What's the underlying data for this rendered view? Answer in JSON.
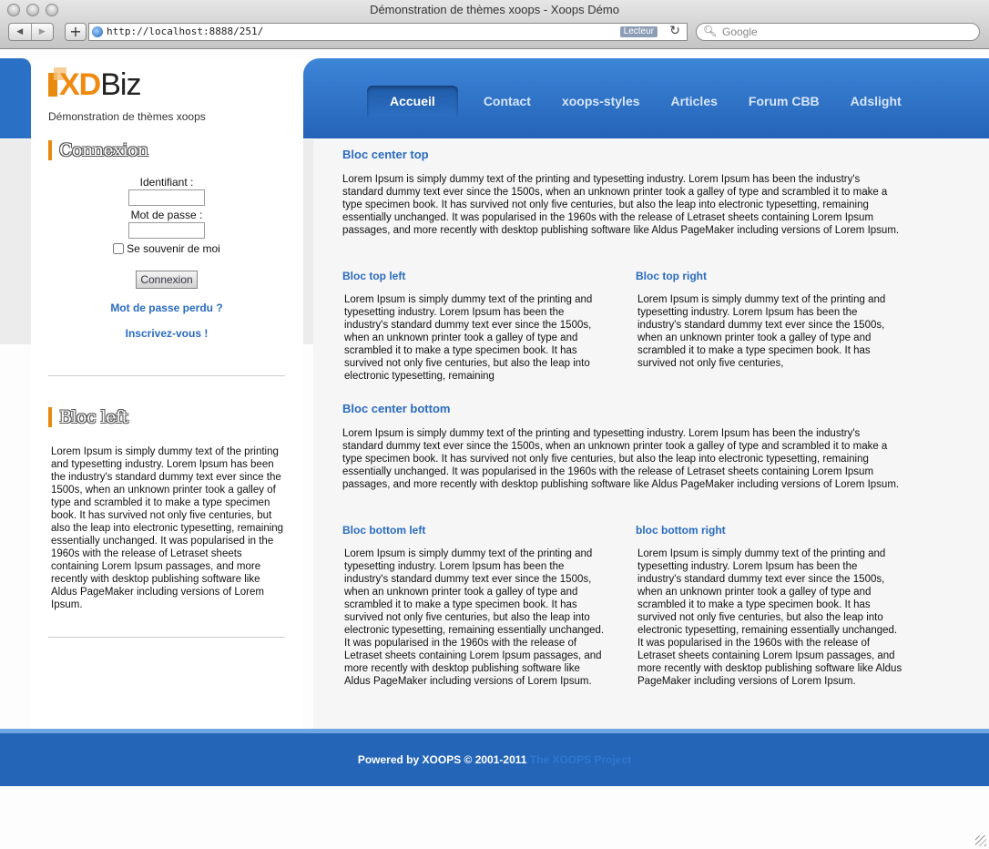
{
  "browser": {
    "window_title": "Démonstration de thèmes xoops - Xoops Démo",
    "back_icon": "◀",
    "forward_icon": "▶",
    "add_icon": "+",
    "url": "http://localhost:8888/251/",
    "reader_label": "Lecteur",
    "reload_icon": "↻",
    "search_icon": "🔍︎",
    "search_placeholder": "Google"
  },
  "site": {
    "logo_xd": "XD",
    "logo_biz": "Biz",
    "subtitle": "Démonstration de thèmes xoops"
  },
  "nav": {
    "items": [
      "Accueil",
      "Contact",
      "xoops-styles",
      "Articles",
      "Forum CBB",
      "Adslight"
    ],
    "active": "Accueil"
  },
  "login_block": {
    "title": "Connexion",
    "username_label": "Identifiant :",
    "password_label": "Mot de passe :",
    "remember_label": "Se souvenir de moi",
    "submit_label": "Connexion",
    "lost_password": "Mot de passe perdu ?",
    "register": "Inscrivez-vous !"
  },
  "left_block": {
    "title": "Bloc left",
    "text": "Lorem Ipsum is simply dummy text of the printing and typesetting industry. Lorem Ipsum has been the industry's standard dummy text ever since the 1500s, when an unknown printer took a galley of type and scrambled it to make a type specimen book. It has survived not only five centuries, but also the leap into electronic typesetting, remaining essentially unchanged. It was popularised in the 1960s with the release of Letraset sheets containing Lorem Ipsum passages, and more recently with desktop publishing software like Aldus PageMaker including versions of Lorem Ipsum."
  },
  "center": {
    "top": {
      "title": "Bloc center top",
      "text": "Lorem Ipsum is simply dummy text of the printing and typesetting industry. Lorem Ipsum has been the industry's standard dummy text ever since the 1500s, when an unknown printer took a galley of type and scrambled it to make a type specimen book. It has survived not only five centuries, but also the leap into electronic typesetting, remaining essentially unchanged. It was popularised in the 1960s with the release of Letraset sheets containing Lorem Ipsum passages, and more recently with desktop publishing software like Aldus PageMaker including versions of Lorem Ipsum."
    },
    "top_left": {
      "title": "Bloc top left",
      "text": "Lorem Ipsum is simply dummy text of the printing and typesetting industry. Lorem Ipsum has been the industry's standard dummy text ever since the 1500s, when an unknown printer took a galley of type and scrambled it to make a type specimen book. It has survived not only five centuries, but also the leap into electronic typesetting, remaining"
    },
    "top_right": {
      "title": "Bloc top right",
      "text": "Lorem Ipsum is simply dummy text of the printing and typesetting industry. Lorem Ipsum has been the industry's standard dummy text ever since the 1500s, when an unknown printer took a galley of type and scrambled it to make a type specimen book. It has survived not only five centuries,"
    },
    "bottom": {
      "title": "Bloc center bottom",
      "text": "Lorem Ipsum is simply dummy text of the printing and typesetting industry. Lorem Ipsum has been the industry's standard dummy text ever since the 1500s, when an unknown printer took a galley of type and scrambled it to make a type specimen book. It has survived not only five centuries, but also the leap into electronic typesetting, remaining essentially unchanged. It was popularised in the 1960s with the release of Letraset sheets containing Lorem Ipsum passages, and more recently with desktop publishing software like Aldus PageMaker including versions of Lorem Ipsum."
    },
    "bottom_left": {
      "title": "Bloc bottom left",
      "text": "Lorem Ipsum is simply dummy text of the printing and typesetting industry. Lorem Ipsum has been the industry's standard dummy text ever since the 1500s, when an unknown printer took a galley of type and scrambled it to make a type specimen book. It has survived not only five centuries, but also the leap into electronic typesetting, remaining essentially unchanged. It was popularised in the 1960s with the release of Letraset sheets containing Lorem Ipsum passages, and more recently with desktop publishing software like Aldus PageMaker including versions of Lorem Ipsum."
    },
    "bottom_right": {
      "title": "bloc bottom right",
      "text": "Lorem Ipsum is simply dummy text of the printing and typesetting industry. Lorem Ipsum has been the industry's standard dummy text ever since the 1500s, when an unknown printer took a galley of type and scrambled it to make a type specimen book. It has survived not only five centuries, but also the leap into electronic typesetting, remaining essentially unchanged. It was popularised in the 1960s with the release of Letraset sheets containing Lorem Ipsum passages, and more recently with desktop publishing software like Aldus PageMaker including versions of Lorem Ipsum."
    }
  },
  "footer": {
    "powered": "Powered by XOOPS © 2001-2011",
    "project_link": "The XOOPS Project"
  },
  "colors": {
    "brand_blue": "#2a6bc0",
    "accent_orange": "#e8890f",
    "footer_blue": "#2465b8"
  }
}
